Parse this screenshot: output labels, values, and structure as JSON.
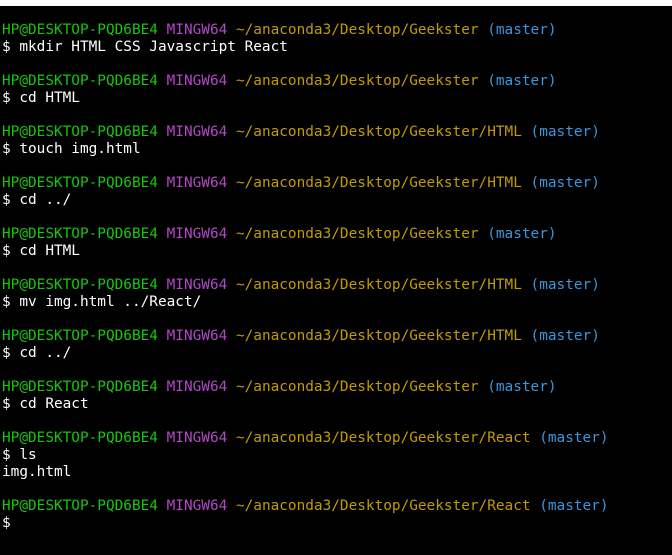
{
  "colors": {
    "background": "#000000",
    "user_host": "#16c60c",
    "system": "#b148c6",
    "path": "#c19c00",
    "branch": "#3a96dd",
    "text": "#ffffff"
  },
  "entries": [
    {
      "user": "HP@DESKTOP-PQD6BE4",
      "system": "MINGW64",
      "path": "~/anaconda3/Desktop/Geekster",
      "branch": "(master)",
      "command": "$ mkdir HTML CSS Javascript React"
    },
    {
      "user": "HP@DESKTOP-PQD6BE4",
      "system": "MINGW64",
      "path": "~/anaconda3/Desktop/Geekster",
      "branch": "(master)",
      "command": "$ cd HTML"
    },
    {
      "user": "HP@DESKTOP-PQD6BE4",
      "system": "MINGW64",
      "path": "~/anaconda3/Desktop/Geekster/HTML",
      "branch": "(master)",
      "command": "$ touch img.html"
    },
    {
      "user": "HP@DESKTOP-PQD6BE4",
      "system": "MINGW64",
      "path": "~/anaconda3/Desktop/Geekster/HTML",
      "branch": "(master)",
      "command": "$ cd ../"
    },
    {
      "user": "HP@DESKTOP-PQD6BE4",
      "system": "MINGW64",
      "path": "~/anaconda3/Desktop/Geekster",
      "branch": "(master)",
      "command": "$ cd HTML"
    },
    {
      "user": "HP@DESKTOP-PQD6BE4",
      "system": "MINGW64",
      "path": "~/anaconda3/Desktop/Geekster/HTML",
      "branch": "(master)",
      "command": "$ mv img.html ../React/"
    },
    {
      "user": "HP@DESKTOP-PQD6BE4",
      "system": "MINGW64",
      "path": "~/anaconda3/Desktop/Geekster/HTML",
      "branch": "(master)",
      "command": "$ cd ../"
    },
    {
      "user": "HP@DESKTOP-PQD6BE4",
      "system": "MINGW64",
      "path": "~/anaconda3/Desktop/Geekster",
      "branch": "(master)",
      "command": "$ cd React"
    },
    {
      "user": "HP@DESKTOP-PQD6BE4",
      "system": "MINGW64",
      "path": "~/anaconda3/Desktop/Geekster/React",
      "branch": "(master)",
      "command": "$ ls",
      "output": "img.html"
    },
    {
      "user": "HP@DESKTOP-PQD6BE4",
      "system": "MINGW64",
      "path": "~/anaconda3/Desktop/Geekster/React",
      "branch": "(master)",
      "command": "$"
    }
  ]
}
